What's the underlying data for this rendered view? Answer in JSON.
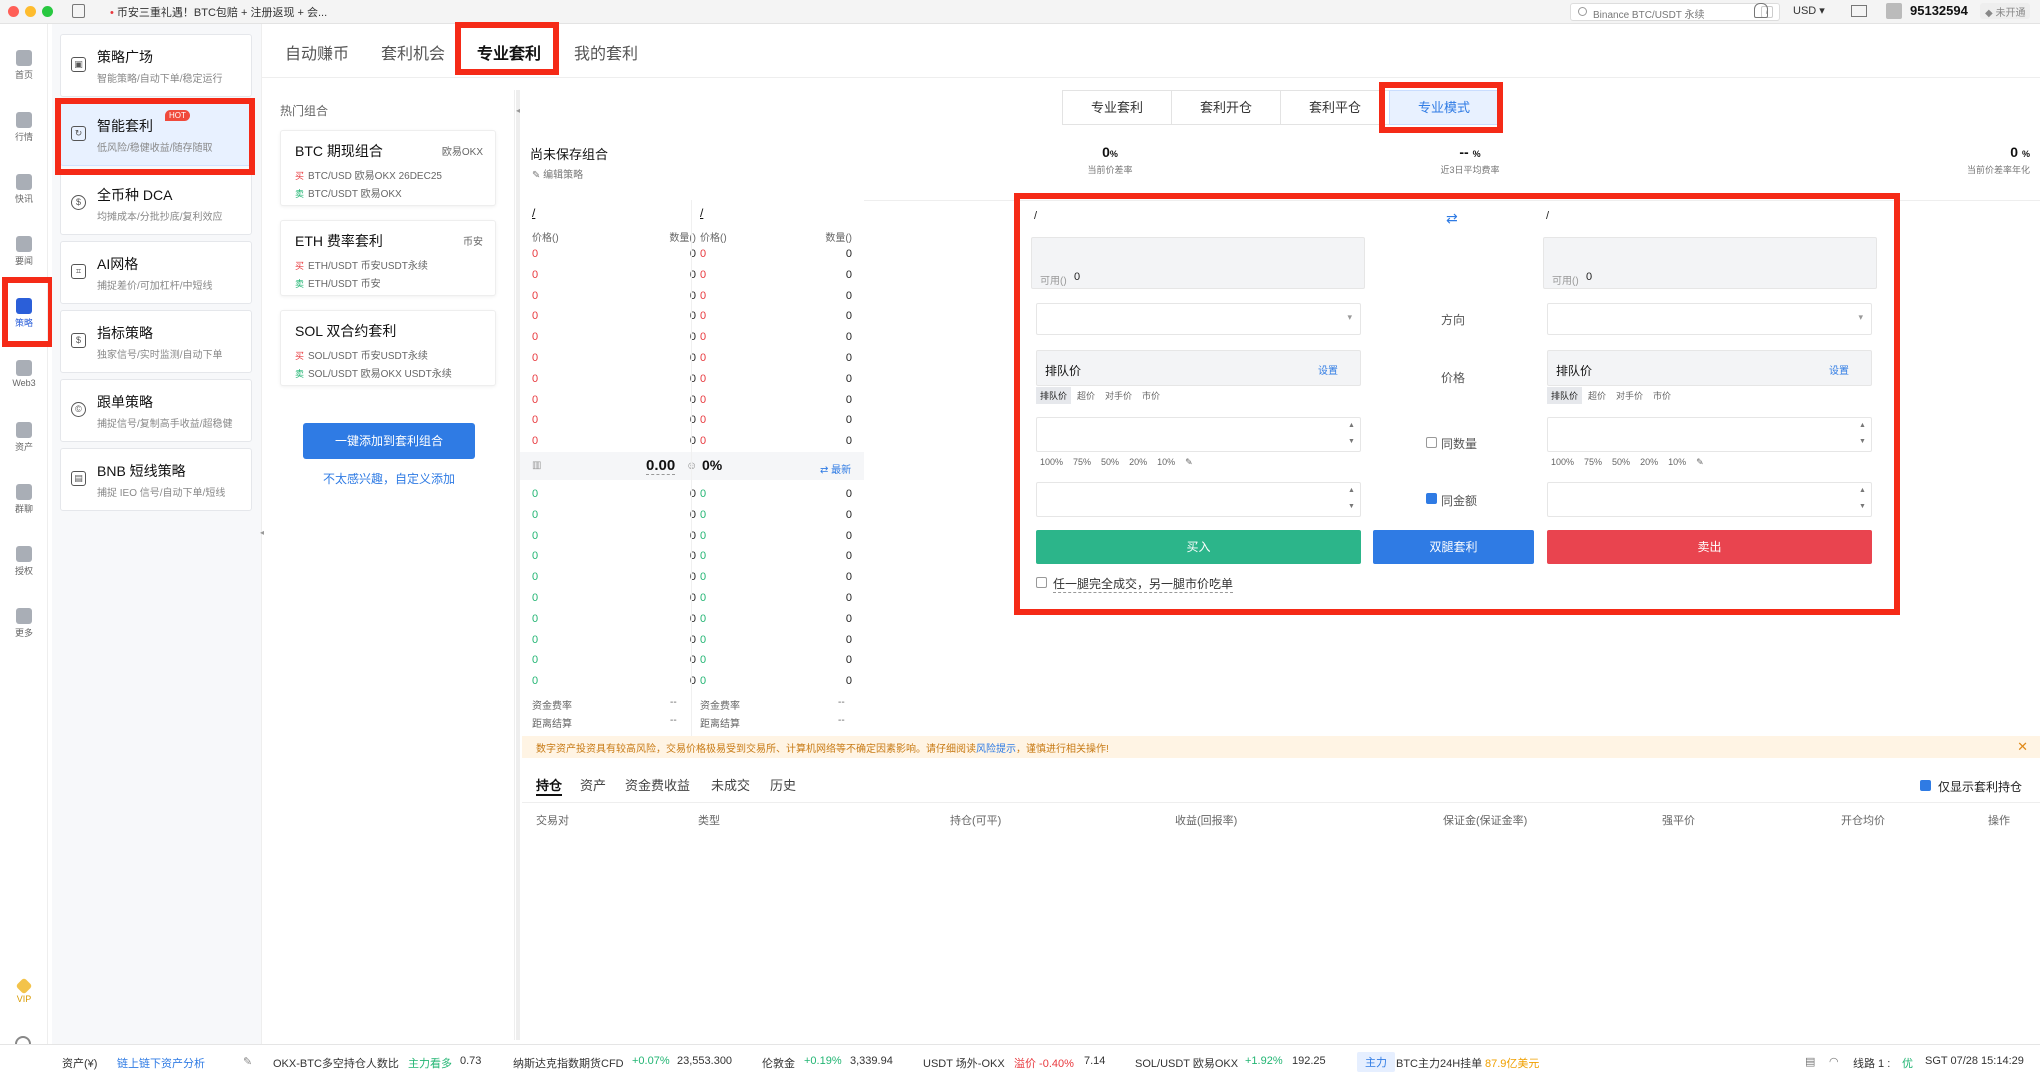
{
  "titlebar": {
    "ticker": "币安三重礼遇！BTC包赔 + 注册返现 + 会...",
    "search_placeholder": "Binance BTC/USDT 永续",
    "search_key": "/",
    "currency": "USD",
    "uid": "95132594",
    "status_badge": "未开通"
  },
  "rail": [
    {
      "label": "首页",
      "icon": "home-icon"
    },
    {
      "label": "行情",
      "icon": "chart-bars-icon"
    },
    {
      "label": "快讯",
      "icon": "news-flash-icon"
    },
    {
      "label": "要闻",
      "icon": "newspaper-icon"
    },
    {
      "label": "策略",
      "icon": "robot-icon"
    },
    {
      "label": "Web3",
      "icon": "web3-icon"
    },
    {
      "label": "资产",
      "icon": "wallet-icon"
    },
    {
      "label": "群聊",
      "icon": "chat-icon"
    },
    {
      "label": "授权",
      "icon": "key-icon"
    },
    {
      "label": "更多",
      "icon": "grid-icon"
    },
    {
      "label": "VIP",
      "icon": "vip-diamond-icon"
    }
  ],
  "menu": [
    {
      "title": "策略广场",
      "sub": "智能策略/自动下单/稳定运行",
      "icon": "robot-icon"
    },
    {
      "title": "智能套利",
      "sub": "低风险/稳健收益/随存随取",
      "icon": "cycle-icon",
      "badge": "HOT"
    },
    {
      "title": "全币种 DCA",
      "sub": "均摊成本/分批抄底/复利效应",
      "icon": "dollar-icon"
    },
    {
      "title": "AI网格",
      "sub": "捕捉差价/可加杠杆/中短线",
      "icon": "grid-chart-icon"
    },
    {
      "title": "指标策略",
      "sub": "独家信号/实时监测/自动下单",
      "icon": "indicator-icon"
    },
    {
      "title": "跟单策略",
      "sub": "捕捉信号/复制高手收益/超稳健",
      "icon": "copy-icon"
    },
    {
      "title": "BNB 短线策略",
      "sub": "捕捉 IEO 信号/自动下单/短线",
      "icon": "bnb-icon"
    }
  ],
  "tabs": [
    "自动赚币",
    "套利机会",
    "专业套利",
    "我的套利"
  ],
  "hot_label": "热门组合",
  "combos": [
    {
      "title": "BTC 期现组合",
      "exchange": "欧易OKX",
      "buy": "BTC/USD 欧易OKX 26DEC25",
      "sell": "BTC/USDT 欧易OKX"
    },
    {
      "title": "ETH 费率套利",
      "exchange": "币安",
      "buy": "ETH/USDT 币安USDT永续",
      "sell": "ETH/USDT 币安"
    },
    {
      "title": "SOL 双合约套利",
      "exchange": "",
      "buy": "SOL/USDT 币安USDT永续",
      "sell": "SOL/USDT 欧易OKX USDT永续"
    }
  ],
  "buy_badge": "买",
  "sell_badge": "卖",
  "add_button": "一键添加到套利组合",
  "custom_link": "不太感兴趣，自定义添加",
  "book": {
    "left_title": "/",
    "right_title": "/",
    "price_header": "价格()",
    "qty_header": "数量()",
    "ask_price": "0",
    "ask_qty": "0",
    "bid_price": "0",
    "bid_qty": "0",
    "mid_value": "0.00",
    "mid_pct": "0%",
    "latest": "最新",
    "funding_label": "资金费率",
    "funding_value": "--",
    "settle_label": "距离结算",
    "settle_value": "--"
  },
  "mode_tabs": [
    "专业套利",
    "套利开仓",
    "套利平仓",
    "专业模式"
  ],
  "summary": {
    "title": "尚未保存组合",
    "edit": "编辑策略",
    "spread_value": "0",
    "spread_unit": "%",
    "spread_label": "当前价差率",
    "avg_value": "--",
    "avg_unit": "%",
    "avg_label": "近3日平均费率",
    "annual_value": "0",
    "annual_unit": "%",
    "annual_label": "当前价差率年化"
  },
  "form": {
    "left_pair": "/",
    "right_pair": "/",
    "available_label": "可用()",
    "available_value": "0",
    "direction_label": "方向",
    "price_label": "价格",
    "price_mode": "排队价",
    "settings": "设置",
    "price_types": [
      "排队价",
      "超价",
      "对手价",
      "市价"
    ],
    "percents": [
      "100%",
      "75%",
      "50%",
      "20%",
      "10%"
    ],
    "same_qty": "同数量",
    "same_amount": "同金额",
    "buy": "买入",
    "dual": "双腿套利",
    "sell": "卖出",
    "fill_option": "任一腿完全成交，另一腿市价吃单"
  },
  "warning": {
    "text": "数字资产投资具有较高风险，交易价格极易受到交易所、计算机网络等不确定因素影响。请仔细阅读",
    "link": "风险提示",
    "tail": "，谨慎进行相关操作!"
  },
  "positions": {
    "tabs": [
      "持仓",
      "资产",
      "资金费收益",
      "未成交",
      "历史"
    ],
    "only_arb": "仅显示套利持仓",
    "headers": [
      "交易对",
      "类型",
      "持仓(可平)",
      "收益(回报率)",
      "保证金(保证金率)",
      "强平价",
      "开仓均价",
      "操作"
    ]
  },
  "statusbar": {
    "assets": "资产(¥)",
    "chain": "链上链下资产分析",
    "okx_label": "OKX-BTC多空持仓人数比",
    "okx_tag": "主力看多",
    "okx_value": "0.73",
    "nasdaq_label": "纳斯达克指数期货CFD",
    "nasdaq_pct": "+0.07%",
    "nasdaq_value": "23,553.300",
    "gold_label": "伦敦金",
    "gold_pct": "+0.19%",
    "gold_value": "3,339.94",
    "usdt_label": "USDT 场外-OKX",
    "usdt_tag": "溢价 -0.40%",
    "usdt_value": "7.14",
    "sol_label": "SOL/USDT 欧易OKX",
    "sol_pct": "+1.92%",
    "sol_value": "192.25",
    "main_tag": "主力",
    "btc_label": "BTC主力24H挂单",
    "btc_value": "87.9亿美元",
    "line_label": "线路 1 :",
    "line_quality": "优",
    "time": "SGT 07/28 15:14:29"
  },
  "colors": {
    "accent": "#2f7be4",
    "buy_green": "#2cb58a",
    "sell_red": "#e9444f",
    "highlight_red": "#f52a17"
  }
}
